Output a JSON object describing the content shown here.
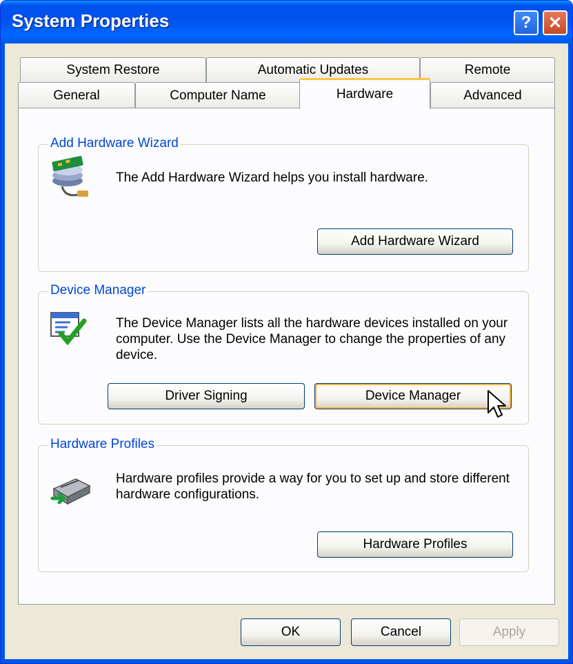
{
  "window": {
    "title": "System Properties"
  },
  "titlebar_buttons": {
    "help": "?",
    "close": "✕"
  },
  "tabs": {
    "row_back": [
      "System Restore",
      "Automatic Updates",
      "Remote"
    ],
    "row_front": [
      "General",
      "Computer Name",
      "Hardware",
      "Advanced"
    ],
    "active": "Hardware"
  },
  "groups": {
    "add_hardware": {
      "legend": "Add Hardware Wizard",
      "text": "The Add Hardware Wizard helps you install hardware.",
      "button": "Add Hardware Wizard",
      "icon": "add-hardware-icon"
    },
    "device_manager": {
      "legend": "Device Manager",
      "text": "The Device Manager lists all the hardware devices installed on your computer. Use the Device Manager to change the properties of any device.",
      "buttons": [
        "Driver Signing",
        "Device Manager"
      ],
      "icon": "device-manager-icon"
    },
    "hardware_profiles": {
      "legend": "Hardware Profiles",
      "text": "Hardware profiles provide a way for you to set up and store different hardware configurations.",
      "button": "Hardware Profiles",
      "icon": "hardware-profiles-icon"
    }
  },
  "footer": {
    "ok": "OK",
    "cancel": "Cancel",
    "apply": "Apply"
  },
  "colors": {
    "title_blue": "#0058EB",
    "legend_blue": "#0046D5",
    "dialog_bg": "#ECE9D8",
    "tab_highlight": "#FFC83C"
  }
}
